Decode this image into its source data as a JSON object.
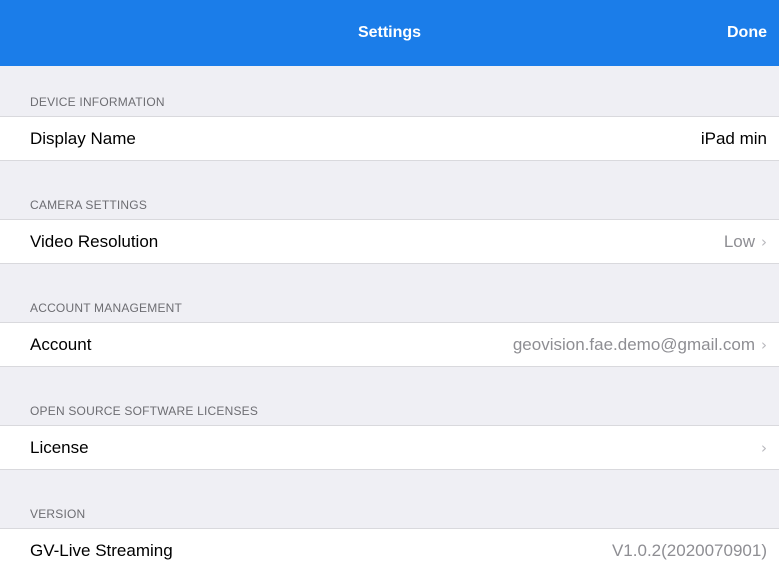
{
  "navbar": {
    "title": "Settings",
    "done_label": "Done"
  },
  "sections": [
    {
      "header": "DEVICE INFORMATION",
      "row_label": "Display Name",
      "row_value": "iPad min"
    },
    {
      "header": "CAMERA SETTINGS",
      "row_label": "Video Resolution",
      "row_value": "Low"
    },
    {
      "header": "ACCOUNT MANAGEMENT",
      "row_label": "Account",
      "row_value": "geovision.fae.demo@gmail.com"
    },
    {
      "header": "OPEN SOURCE SOFTWARE LICENSES",
      "row_label": "License",
      "row_value": ""
    },
    {
      "header": "VERSION",
      "row_label": "GV-Live Streaming",
      "row_value": "V1.0.2(2020070901)"
    }
  ],
  "colors": {
    "navbar": "#1b7de9",
    "background": "#efeff4",
    "secondary_text": "#8e8e93"
  },
  "icons": {
    "chevron": "chevron-right-icon"
  }
}
